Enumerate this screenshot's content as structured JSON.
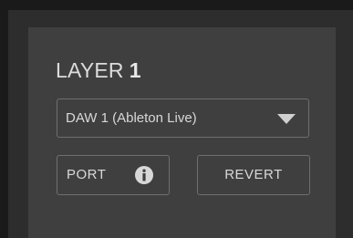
{
  "layer": {
    "title_prefix": "LAYER",
    "number": "1"
  },
  "daw_select": {
    "value": "DAW 1 (Ableton Live)",
    "icon": "chevron-down-icon"
  },
  "buttons": {
    "port_label": "PORT",
    "port_icon": "info-icon",
    "revert_label": "REVERT"
  }
}
